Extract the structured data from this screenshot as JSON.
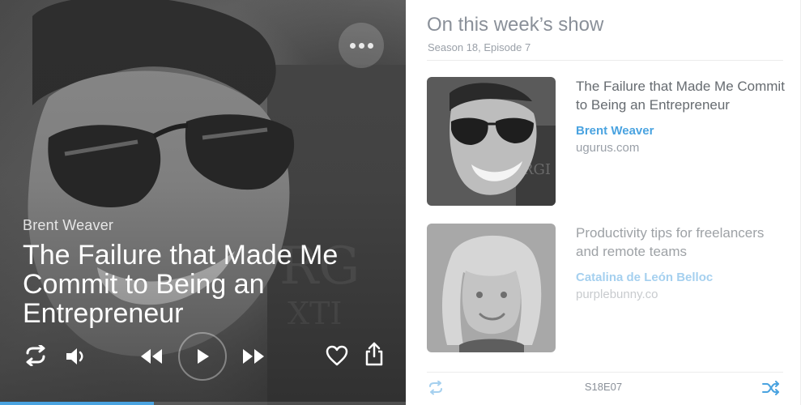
{
  "player": {
    "speaker": "Brent Weaver",
    "title": "The Failure that Made Me Commit to Being an Entrepreneur",
    "progress": 0.38,
    "accent_color": "#4aa3e0",
    "icons": [
      "more-icon",
      "repeat-icon",
      "volume-icon",
      "rewind-icon",
      "play-icon",
      "fast-forward-icon",
      "heart-icon",
      "share-icon"
    ]
  },
  "panel": {
    "title": "On this week’s show",
    "subtitle": "Season 18, Episode 7",
    "episodes": [
      {
        "title": "The Failure that Made Me Commit to Being an Entrepreneur",
        "speaker": "Brent Weaver",
        "site": "ugurus.com"
      },
      {
        "title": "Productivity tips for freelancers and remote teams",
        "speaker": "Catalina de León Belloc",
        "site": "purplebunny.co"
      }
    ],
    "footer": {
      "code": "S18E07",
      "icons": [
        "repeat-icon",
        "shuffle-icon"
      ]
    }
  }
}
